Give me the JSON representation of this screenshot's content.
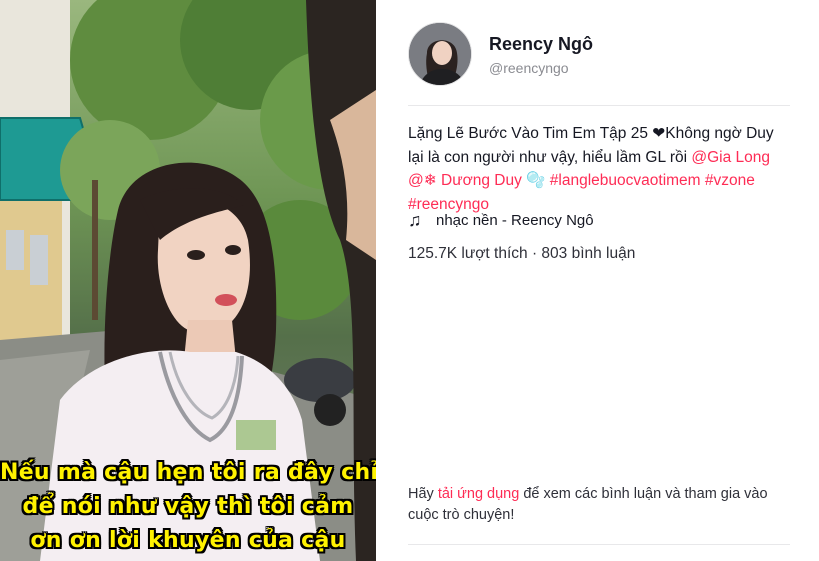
{
  "video": {
    "caption_lines": [
      "Nếu mà cậu hẹn tôi ra đây chỉ",
      "để nói như vậy thì tôi cảm",
      "ơn ơn lời khuyên của cậu"
    ]
  },
  "author": {
    "name": "Reency Ngô",
    "handle": "@reencyngo"
  },
  "description": {
    "text_1": "Lặng Lẽ Bước Vào Tim Em Tập 25 ❤Không ngờ Duy lại là con người như vậy, hiểu lầm GL rồi ",
    "mention_1": "@Gia Long",
    "text_2": " ",
    "mention_2": "@❄ Dương Duy 🫧",
    "text_3": " ",
    "hashtag_1": "#langlebuocvaotimem",
    "text_4": " ",
    "hashtag_2": "#vzone",
    "text_5": " ",
    "hashtag_3": "#reencyngo"
  },
  "music": {
    "icon": "music-note-icon",
    "label": "nhạc nền - Reency Ngô"
  },
  "stats": {
    "text": "125.7K lượt thích · 803 bình luận"
  },
  "comment_prompt": {
    "before": "Hãy ",
    "link": "tải ứng dụng",
    "after": " để xem các bình luận và tham gia vào cuộc trò chuyện!"
  },
  "colors": {
    "accent": "#fe2c55",
    "caption": "#fff200",
    "text": "#161823",
    "muted": "#8a8b91"
  }
}
